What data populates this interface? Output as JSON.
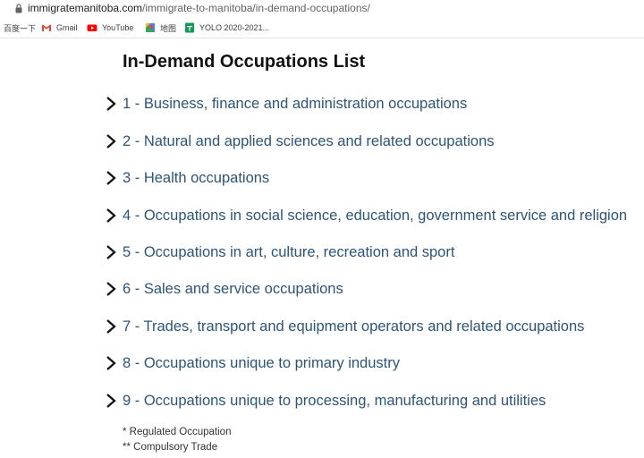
{
  "browser": {
    "url_host": "immigratemanitoba.com",
    "url_path": "/immigrate-to-manitoba/in-demand-occupations/",
    "bookmarks": [
      {
        "label": "百度一下",
        "icon": "baidu-icon"
      },
      {
        "label": "Gmail",
        "icon": "gmail-icon"
      },
      {
        "label": "YouTube",
        "icon": "youtube-icon"
      },
      {
        "label": "地图",
        "icon": "maps-icon"
      },
      {
        "label": "YOLO 2020-2021...",
        "icon": "sheets-icon"
      }
    ]
  },
  "page": {
    "title": "In-Demand Occupations List",
    "items": [
      {
        "label": "1 - Business, finance and administration occupations"
      },
      {
        "label": "2 - Natural and applied sciences and related occupations"
      },
      {
        "label": "3 - Health occupations"
      },
      {
        "label": "4 - Occupations in social science, education, government service and religion"
      },
      {
        "label": "5 - Occupations in art, culture, recreation and sport"
      },
      {
        "label": "6 - Sales and service occupations"
      },
      {
        "label": "7 - Trades, transport and equipment operators and related occupations"
      },
      {
        "label": "8 - Occupations unique to primary industry"
      },
      {
        "label": "9 - Occupations unique to processing, manufacturing and utilities"
      }
    ],
    "notes": {
      "regulated": "* Regulated Occupation",
      "compulsory": "** Compulsory Trade"
    }
  },
  "colors": {
    "link": "#2c5578",
    "title": "#111111",
    "gmail_red": "#ea4335",
    "youtube_red": "#ff0000",
    "sheets_green": "#0f9d58"
  }
}
